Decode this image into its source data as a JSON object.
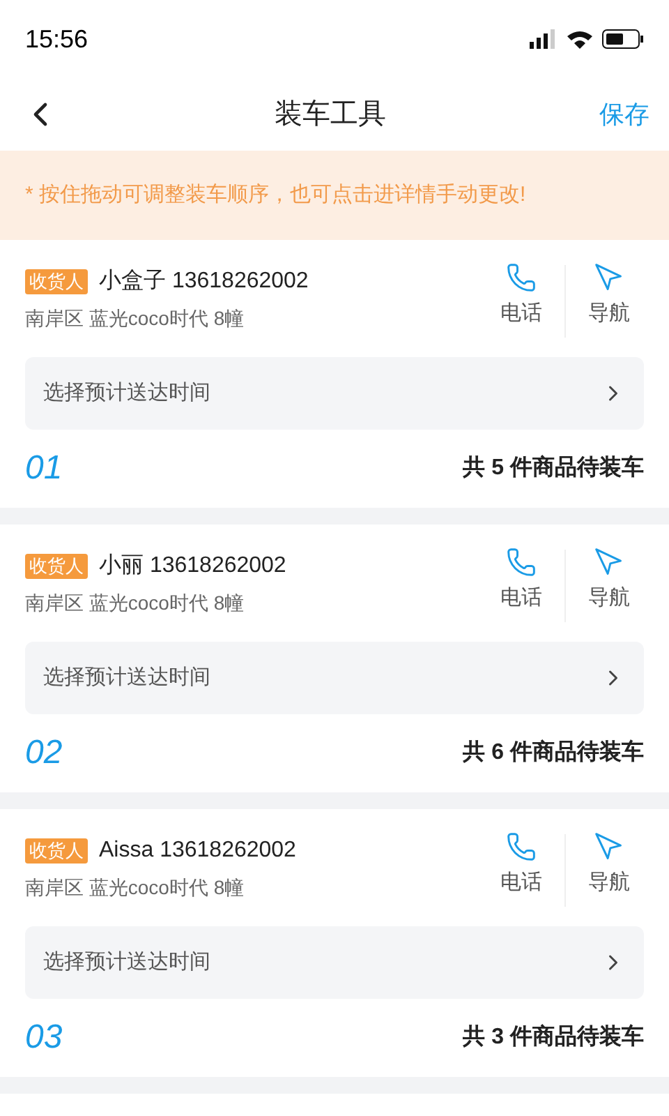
{
  "status_bar": {
    "time": "15:56"
  },
  "header": {
    "title": "装车工具",
    "action": "保存"
  },
  "notice": "* 按住拖动可调整装车顺序，也可点击进详情手动更改!",
  "orders": [
    {
      "badge": "收货人",
      "name": "小盒子 13618262002",
      "address": "南岸区 蓝光coco时代 8幢",
      "call": "电话",
      "navigate": "导航",
      "time_picker": "选择预计送达时间",
      "number": "01",
      "summary": "共 5 件商品待装车"
    },
    {
      "badge": "收货人",
      "name": "小丽 13618262002",
      "address": "南岸区 蓝光coco时代 8幢",
      "call": "电话",
      "navigate": "导航",
      "time_picker": "选择预计送达时间",
      "number": "02",
      "summary": "共 6 件商品待装车"
    },
    {
      "badge": "收货人",
      "name": "Aissa 13618262002",
      "address": "南岸区 蓝光coco时代 8幢",
      "call": "电话",
      "navigate": "导航",
      "time_picker": "选择预计送达时间",
      "number": "03",
      "summary": "共 3 件商品待装车"
    }
  ]
}
